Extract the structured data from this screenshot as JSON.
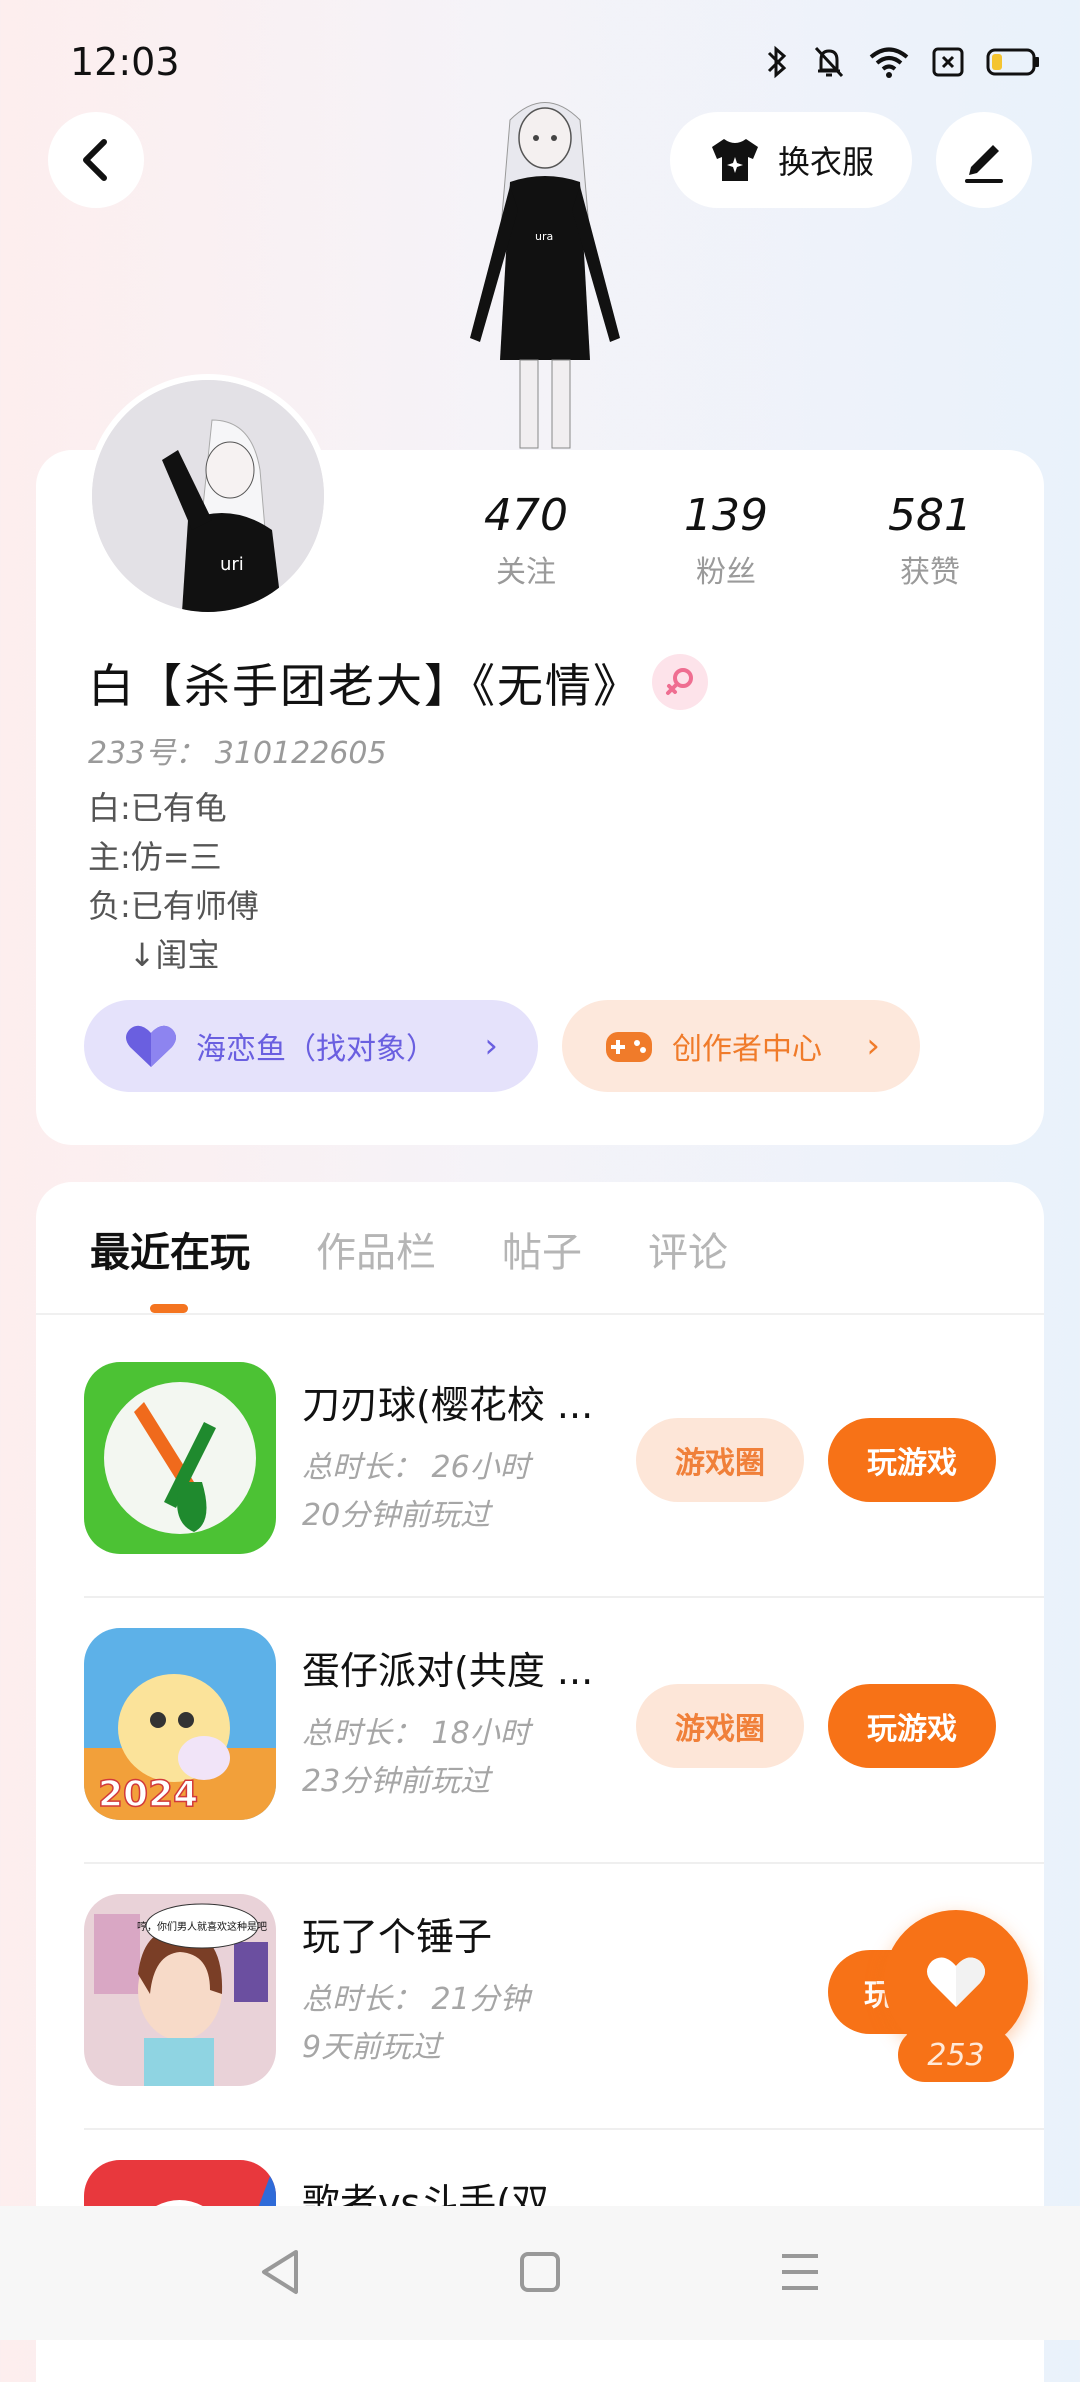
{
  "status_bar": {
    "time": "12:03"
  },
  "header": {
    "dress_up_label": "换衣服"
  },
  "profile": {
    "stats": [
      {
        "value": "470",
        "label": "关注"
      },
      {
        "value": "139",
        "label": "粉丝"
      },
      {
        "value": "581",
        "label": "获赞"
      }
    ],
    "username": "白【杀手团老大】《无情》",
    "uid": "233号： 310122605",
    "bio": [
      "白:已有龟",
      "主:仿=三",
      "负:已有师傅",
      "    ↓闺宝"
    ],
    "love_pill": "海恋鱼（找对象）",
    "creator_pill": "创作者中心"
  },
  "tabs": [
    "最近在玩",
    "作品栏",
    "帖子",
    "评论"
  ],
  "games": [
    {
      "title": "刀刃球(樱花校 ...",
      "duration": "总时长： 26小时",
      "last_played": "20分钟前玩过",
      "circle_label": "游戏圈",
      "play_label": "玩游戏"
    },
    {
      "title": "蛋仔派对(共度 ...",
      "duration": "总时长： 18小时",
      "last_played": "23分钟前玩过",
      "circle_label": "游戏圈",
      "play_label": "玩游戏"
    },
    {
      "title": "玩了个锤子",
      "duration": "总时长： 21分钟",
      "last_played": "9天前玩过",
      "circle_label": "",
      "play_label": "玩"
    },
    {
      "title": "歌者vs斗手(双"
    }
  ],
  "game2_badge": "2024",
  "game3_bubble": "哼，你们男人就喜欢这种是吧",
  "like": {
    "count": "253"
  },
  "colors": {
    "accent": "#f77217",
    "love": "#6a5fe0"
  }
}
